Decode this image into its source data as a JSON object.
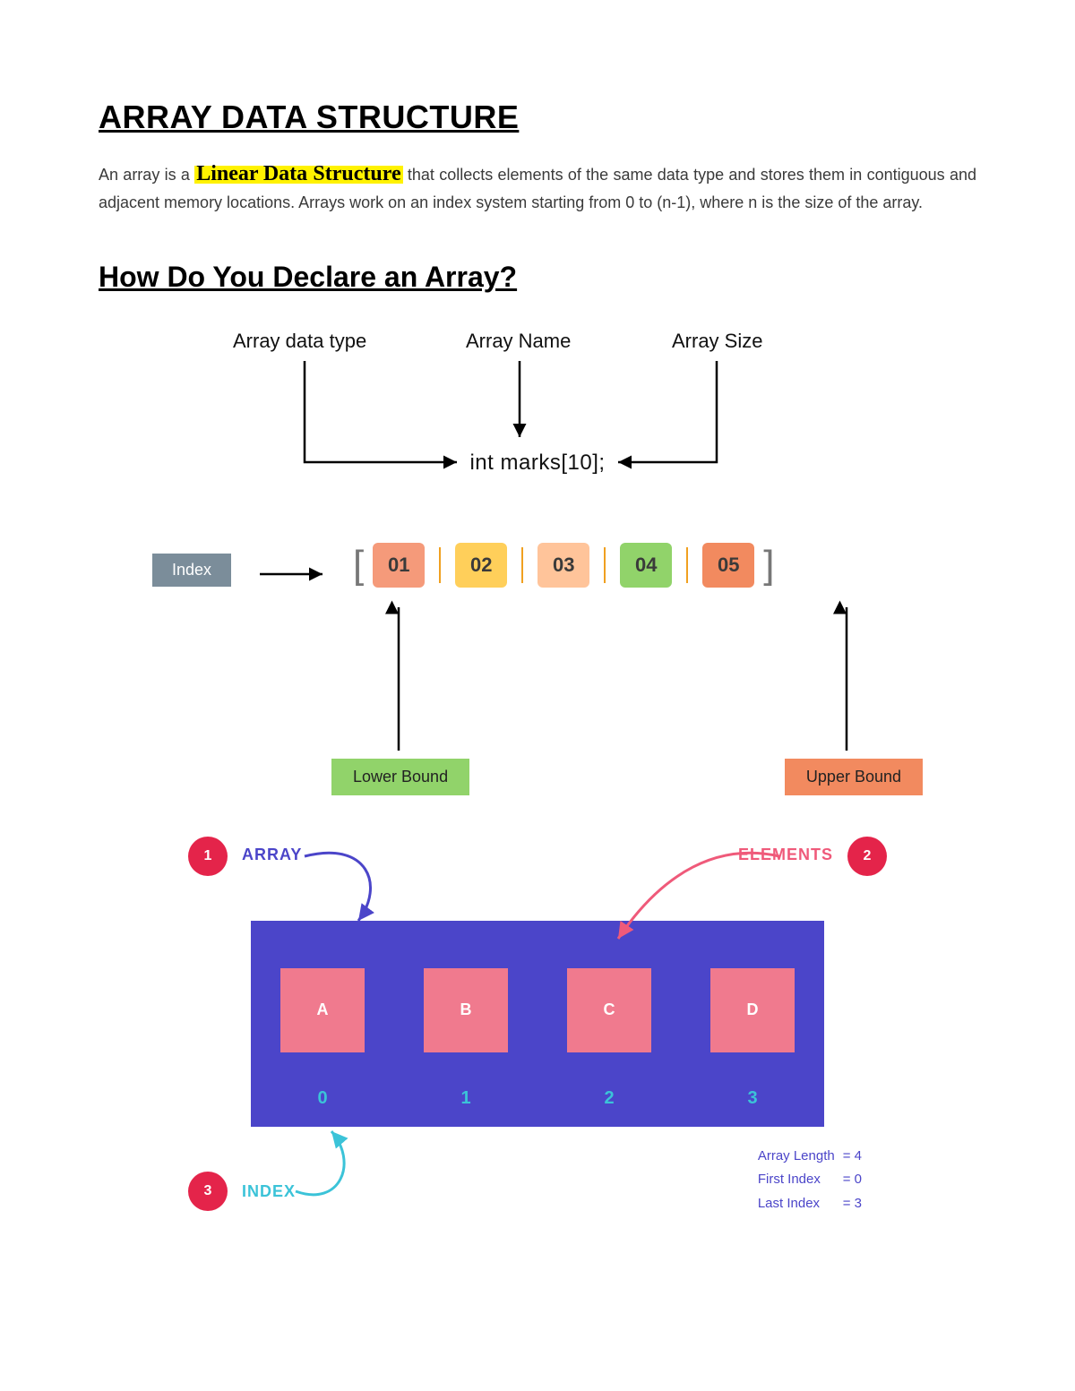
{
  "title": "ARRAY DATA STRUCTURE",
  "intro": {
    "pre": "An array is a ",
    "highlight_linear": "Linear",
    "highlight_sep": " ",
    "highlight_ds": "Data Structure",
    "post": " that collects elements of the same data type and stores them in contiguous and adjacent memory locations. Arrays work on an index system starting from 0 to (n-1), where n is the size of the array."
  },
  "subtitle": "How Do You Declare an Array?",
  "diag1": {
    "label_type": "Array data type",
    "label_name": "Array Name",
    "label_size": "Array Size",
    "declaration": "int marks[10];"
  },
  "diag2": {
    "index_label": "Index",
    "cells": [
      "01",
      "02",
      "03",
      "04",
      "05"
    ],
    "lower_bound": "Lower Bound",
    "upper_bound": "Upper Bound"
  },
  "diag3": {
    "badges": {
      "array": "1",
      "elements": "2",
      "index": "3"
    },
    "caption_array": "ARRAY",
    "caption_elements": "ELEMENTS",
    "caption_index": "INDEX",
    "elements": [
      "A",
      "B",
      "C",
      "D"
    ],
    "indexes": [
      "0",
      "1",
      "2",
      "3"
    ],
    "stats": {
      "length_label": "Array Length",
      "length_value": "= 4",
      "first_label": "First Index",
      "first_value": "= 0",
      "last_label": "Last Index",
      "last_value": "= 3"
    }
  }
}
